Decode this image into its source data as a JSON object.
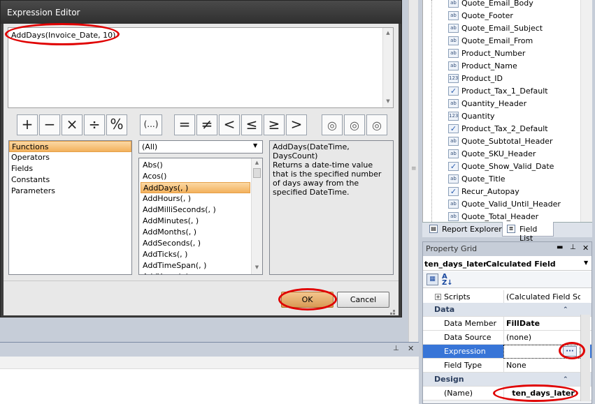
{
  "dialog": {
    "title": "Expression Editor",
    "expression": "AddDays(Invoice_Date, 10)"
  },
  "operators": [
    {
      "sym": "+",
      "name": "plus-button"
    },
    {
      "sym": "−",
      "name": "minus-button"
    },
    {
      "sym": "×",
      "name": "multiply-button"
    },
    {
      "sym": "÷",
      "name": "divide-button"
    },
    {
      "sym": "%",
      "name": "modulo-button"
    },
    {
      "sym": "(...)",
      "name": "parentheses-button"
    },
    {
      "sym": "=",
      "name": "equal-button"
    },
    {
      "sym": "≠",
      "name": "not-equal-button"
    },
    {
      "sym": "<",
      "name": "less-button"
    },
    {
      "sym": "≤",
      "name": "less-equal-button"
    },
    {
      "sym": "≥",
      "name": "greater-equal-button"
    },
    {
      "sym": ">",
      "name": "greater-button"
    }
  ],
  "categories": [
    "Functions",
    "Operators",
    "Fields",
    "Constants",
    "Parameters"
  ],
  "filter": {
    "selected": "(All)"
  },
  "functions": [
    "Abs()",
    "Acos()",
    "AddDays(, )",
    "AddHours(, )",
    "AddMilliSeconds(, )",
    "AddMinutes(, )",
    "AddMonths(, )",
    "AddSeconds(, )",
    "AddTicks(, )",
    "AddTimeSpan(, )",
    "AddYears(, )"
  ],
  "description": "AddDays(DateTime, DaysCount)\nReturns a date-time value that is the specified number of days away from the specified DateTime.",
  "buttons": {
    "ok": "OK",
    "cancel": "Cancel"
  },
  "field_list": [
    {
      "name": "Quote_Email_Body",
      "type": "ab"
    },
    {
      "name": "Quote_Footer",
      "type": "ab"
    },
    {
      "name": "Quote_Email_Subject",
      "type": "ab"
    },
    {
      "name": "Quote_Email_From",
      "type": "ab"
    },
    {
      "name": "Product_Number",
      "type": "ab"
    },
    {
      "name": "Product_Name",
      "type": "ab"
    },
    {
      "name": "Product_ID",
      "type": "123"
    },
    {
      "name": "Product_Tax_1_Default",
      "type": "chk"
    },
    {
      "name": "Quantity_Header",
      "type": "ab"
    },
    {
      "name": "Quantity",
      "type": "123"
    },
    {
      "name": "Product_Tax_2_Default",
      "type": "chk"
    },
    {
      "name": "Quote_Subtotal_Header",
      "type": "ab"
    },
    {
      "name": "Quote_SKU_Header",
      "type": "ab"
    },
    {
      "name": "Quote_Show_Valid_Date",
      "type": "chk"
    },
    {
      "name": "Quote_Title",
      "type": "ab"
    },
    {
      "name": "Recur_Autopay",
      "type": "chk"
    },
    {
      "name": "Quote_Valid_Until_Header",
      "type": "ab"
    },
    {
      "name": "Quote_Total_Header",
      "type": "ab"
    }
  ],
  "tabs": {
    "report_explorer": "Report Explorer",
    "field_list": "Field List"
  },
  "property_grid": {
    "title": "Property Grid",
    "object_name": "ten_days_later",
    "object_type": "Calculated Field",
    "scripts": {
      "label": "Scripts",
      "value": "(Calculated Field Sc..."
    },
    "cat_data": "Data",
    "cat_design": "Design",
    "rows": [
      {
        "label": "Data Member",
        "value": "FillDate"
      },
      {
        "label": "Data Source",
        "value": "(none)"
      },
      {
        "label": "Expression",
        "value": ""
      },
      {
        "label": "Field Type",
        "value": "None"
      }
    ],
    "name_row": {
      "label": "(Name)",
      "value": "ten_days_later"
    }
  }
}
